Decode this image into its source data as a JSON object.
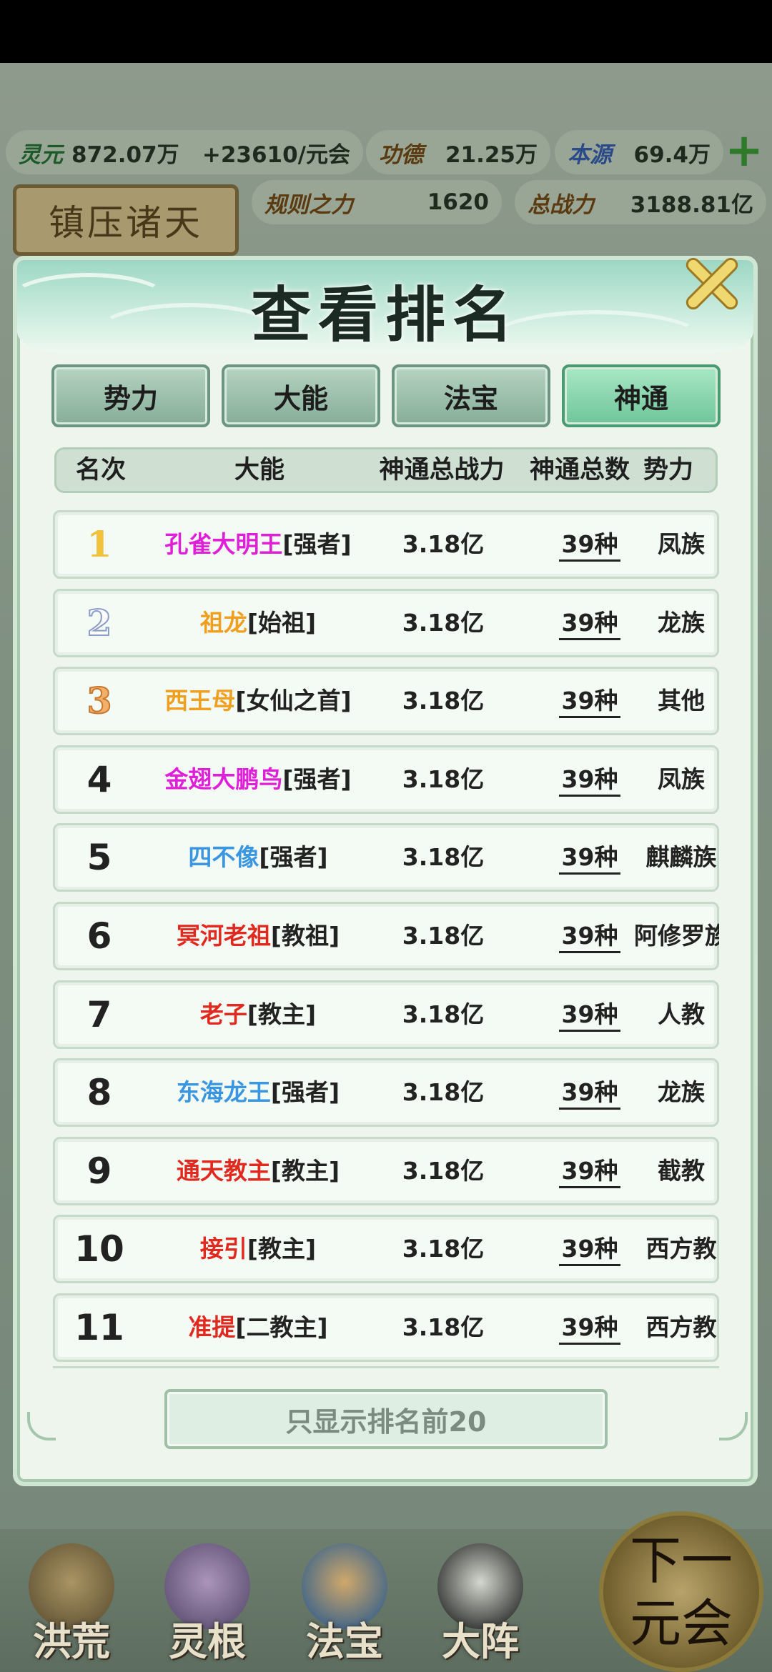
{
  "hud": {
    "lingyuan_label": "灵元",
    "lingyuan_value": "872.07万",
    "income": "+23610/元会",
    "gongde_label": "功德",
    "gongde_value": "21.25万",
    "benyuan_label": "本源",
    "benyuan_value": "69.4万",
    "guize_label": "规则之力",
    "guize_value": "1620",
    "zongzhanli_label": "总战力",
    "zongzhanli_value": "3188.81亿",
    "title_plaque": "镇压诸天"
  },
  "modal": {
    "title": "查看排名",
    "tabs": [
      {
        "label": "势力",
        "active": false
      },
      {
        "label": "大能",
        "active": false
      },
      {
        "label": "法宝",
        "active": false
      },
      {
        "label": "神通",
        "active": true
      }
    ],
    "columns": [
      "名次",
      "大能",
      "神通总战力",
      "神通总数",
      "势力"
    ],
    "rows": [
      {
        "rank": "1",
        "name": "孔雀大明王",
        "title": "[强者]",
        "name_color": "#e020d8",
        "power": "3.18亿",
        "count": "39种",
        "faction": "凤族"
      },
      {
        "rank": "2",
        "name": "祖龙",
        "title": "[始祖]",
        "name_color": "#f0a020",
        "power": "3.18亿",
        "count": "39种",
        "faction": "龙族"
      },
      {
        "rank": "3",
        "name": "西王母",
        "title": "[女仙之首]",
        "name_color": "#f0a020",
        "power": "3.18亿",
        "count": "39种",
        "faction": "其他"
      },
      {
        "rank": "4",
        "name": "金翅大鹏鸟",
        "title": "[强者]",
        "name_color": "#e020d8",
        "power": "3.18亿",
        "count": "39种",
        "faction": "凤族"
      },
      {
        "rank": "5",
        "name": "四不像",
        "title": "[强者]",
        "name_color": "#3a96e0",
        "power": "3.18亿",
        "count": "39种",
        "faction": "麒麟族"
      },
      {
        "rank": "6",
        "name": "冥河老祖",
        "title": "[教祖]",
        "name_color": "#e02a20",
        "power": "3.18亿",
        "count": "39种",
        "faction": "阿修罗族"
      },
      {
        "rank": "7",
        "name": "老子",
        "title": "[教主]",
        "name_color": "#e02a20",
        "power": "3.18亿",
        "count": "39种",
        "faction": "人教"
      },
      {
        "rank": "8",
        "name": "东海龙王",
        "title": "[强者]",
        "name_color": "#3a96e0",
        "power": "3.18亿",
        "count": "39种",
        "faction": "龙族"
      },
      {
        "rank": "9",
        "name": "通天教主",
        "title": "[教主]",
        "name_color": "#e02a20",
        "power": "3.18亿",
        "count": "39种",
        "faction": "截教"
      },
      {
        "rank": "10",
        "name": "接引",
        "title": "[教主]",
        "name_color": "#e02a20",
        "power": "3.18亿",
        "count": "39种",
        "faction": "西方教"
      },
      {
        "rank": "11",
        "name": "准提",
        "title": "[二教主]",
        "name_color": "#e02a20",
        "power": "3.18亿",
        "count": "39种",
        "faction": "西方教"
      }
    ],
    "limit_button": "只显示排名前20"
  },
  "nav": {
    "items": [
      "洪荒",
      "灵根",
      "法宝",
      "大阵"
    ],
    "next_line1": "下一",
    "next_line2": "元会"
  },
  "colors": {
    "accent_green": "#6fc49a",
    "close_gold": "#f0d870",
    "modal_bg": "#edf5ec"
  },
  "icons": [
    "plus-icon",
    "close-icon",
    "cloud-ornament",
    "rank-medal-icon"
  ]
}
